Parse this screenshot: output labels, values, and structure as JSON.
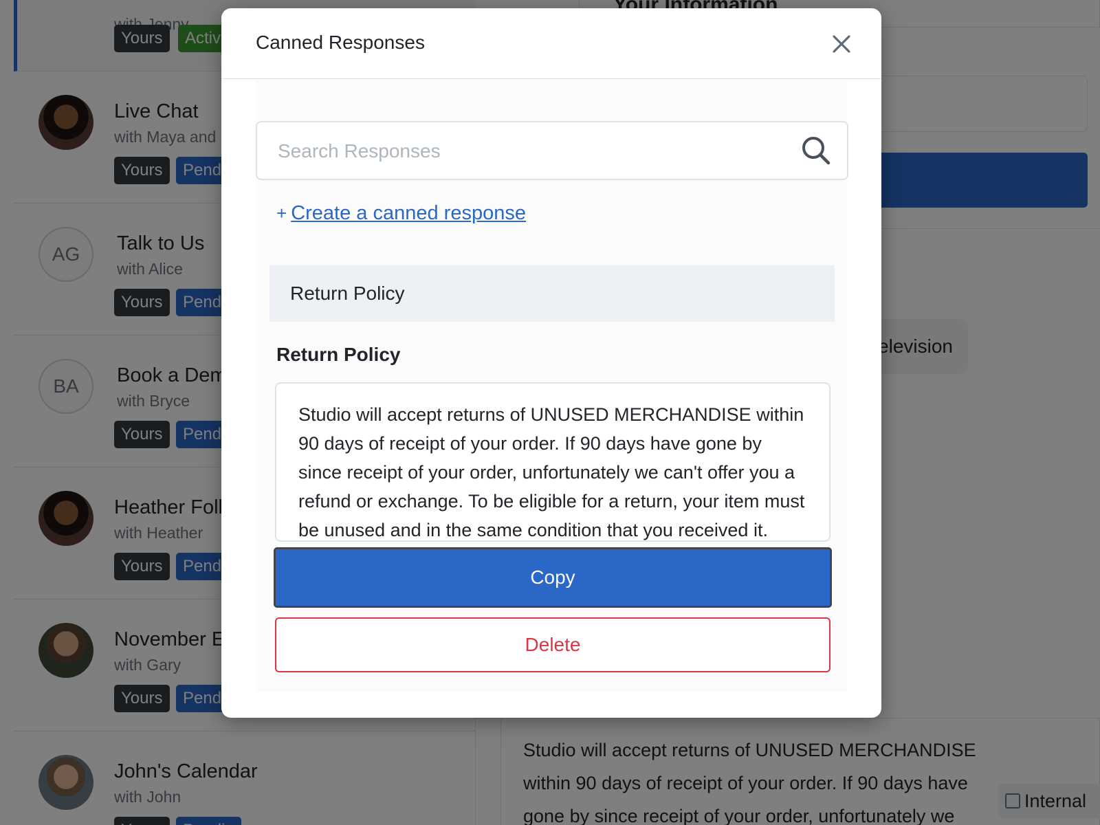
{
  "conversations": [
    {
      "title": "",
      "subtitle": "with Jenny",
      "initials": "",
      "badges": [
        "Yours",
        "Activ"
      ]
    },
    {
      "title": "Live Chat",
      "subtitle": "with Maya and",
      "initials": "",
      "badges": [
        "Yours",
        "Pend"
      ]
    },
    {
      "title": "Talk to Us",
      "subtitle": "with Alice",
      "initials": "AG",
      "badges": [
        "Yours",
        "Pend"
      ]
    },
    {
      "title": "Book a Dem",
      "subtitle": "with Bryce",
      "initials": "BA",
      "badges": [
        "Yours",
        "Pend"
      ]
    },
    {
      "title": "Heather Foll",
      "subtitle": "with Heather",
      "initials": "",
      "badges": [
        "Yours",
        "Pend"
      ]
    },
    {
      "title": "November E",
      "subtitle": "with Gary",
      "initials": "",
      "badges": [
        "Yours",
        "Pend"
      ]
    },
    {
      "title": "John's Calendar",
      "subtitle": "with John",
      "initials": "",
      "badges": [
        "Yours",
        "Pendin"
      ]
    }
  ],
  "background": {
    "info_title": "Your Information",
    "chip_text": "elevision",
    "compose_text": "Studio will accept returns of UNUSED MERCHANDISE within 90 days of receipt of your order. If 90 days have gone by since receipt of your order, unfortunately we",
    "internal_label": "Internal"
  },
  "modal": {
    "title": "Canned Responses",
    "search_placeholder": "Search Responses",
    "create_plus": "+",
    "create_label": "Create a canned response",
    "list_items": [
      "Return Policy"
    ],
    "selected_title": "Return Policy",
    "selected_text": "Studio will accept returns of UNUSED MERCHANDISE within 90 days of receipt of your order. If 90 days have gone by since receipt of your order, unfortunately we can't offer you a refund or exchange. To be eligible for a return, your item must be unused and in the same condition that you received it.",
    "copy_label": "Copy",
    "delete_label": "Delete"
  },
  "colors": {
    "primary": "#2b67c6",
    "danger": "#dc3545",
    "dark_badge": "#343a40",
    "active_badge": "#3e9a35"
  }
}
